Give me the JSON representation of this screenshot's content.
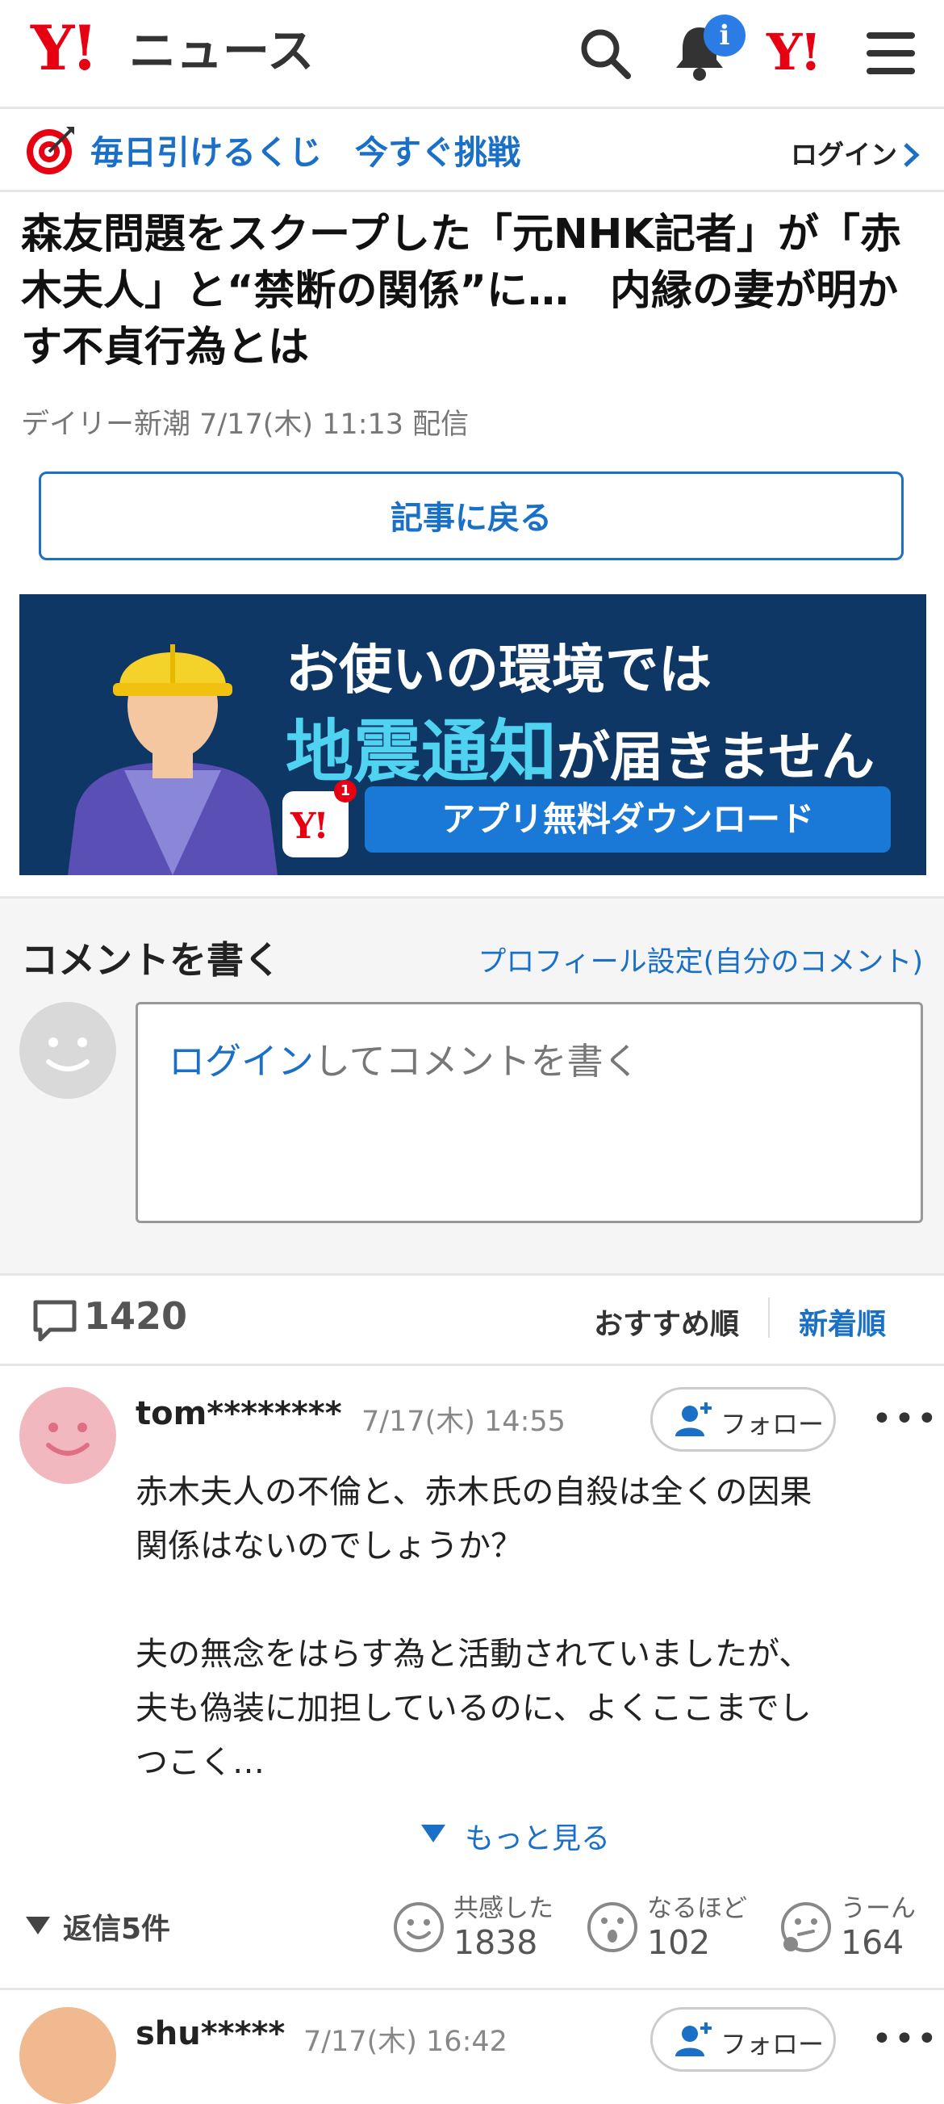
{
  "header": {
    "logo": "Y!",
    "logo_text": "ニュース",
    "notification_badge": "i",
    "yahoo_mini": "Y!"
  },
  "lottery": {
    "text": "毎日引けるくじ　今すぐ挑戦",
    "login": "ログイン"
  },
  "article": {
    "title": "森友問題をスクープした「元NHK記者」が「赤木夫人」と“禁断の関係”に…　内縁の妻が明かす不貞行為とは",
    "meta": "デイリー新潮 7/17(木) 11:13 配信",
    "back_button": "記事に戻る"
  },
  "banner": {
    "line1": "お使いの環境では",
    "highlight": "地震通知",
    "line2_rest": "が届きません",
    "button": "アプリ無料ダウンロード",
    "app_badge": "1",
    "app_logo": "Y!"
  },
  "comment_write": {
    "title": "コメントを書く",
    "profile_link": "プロフィール設定(自分のコメント)",
    "login_word": "ログイン",
    "placeholder_rest": "してコメントを書く"
  },
  "comments_bar": {
    "count": "1420",
    "sort_recommended": "おすすめ順",
    "sort_new": "新着順"
  },
  "comments": [
    {
      "user": "tom********",
      "date": "7/17(木) 14:55",
      "follow": "フォロー",
      "body": "赤木夫人の不倫と、赤木氏の自殺は全くの因果\n関係はないのでしょうか？\n\n夫の無念をはらす為と活動されていましたが、\n夫も偽装に加担しているのに、よくここまでし\nつこく…",
      "more": "もっと見る",
      "replies": "返信5件",
      "reactions": [
        {
          "label": "共感した",
          "count": "1838"
        },
        {
          "label": "なるほど",
          "count": "102"
        },
        {
          "label": "うーん",
          "count": "164"
        }
      ]
    },
    {
      "user": "shu*****",
      "date": "7/17(木) 16:42",
      "follow": "フォロー"
    }
  ],
  "colors": {
    "brand_red": "#e60012",
    "link_blue": "#1a6fc7",
    "banner_bg": "#0e3766"
  },
  "icons": [
    "search-icon",
    "bell-icon",
    "menu-icon",
    "target-icon",
    "chevron-right-icon",
    "comment-icon",
    "follow-user-icon",
    "more-dots-icon",
    "triangle-down-icon",
    "smile-reaction-icon",
    "surprise-reaction-icon",
    "hmm-reaction-icon"
  ]
}
